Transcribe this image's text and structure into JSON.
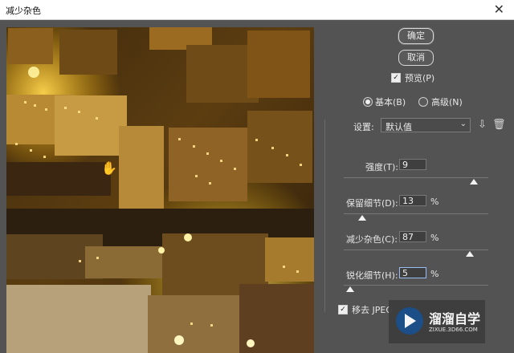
{
  "window": {
    "title": "减少杂色"
  },
  "buttons": {
    "ok": "确定",
    "cancel": "取消"
  },
  "preview": {
    "label": "预览(P)",
    "checked": true
  },
  "mode": {
    "basic": "基本(B)",
    "advanced": "高级(N)",
    "selected": "basic"
  },
  "settings": {
    "label": "设置:",
    "value": "默认值"
  },
  "controls": [
    {
      "label": "强度(T):",
      "value": "9",
      "unit": "",
      "level": 0.9
    },
    {
      "label": "保留细节(D):",
      "value": "13",
      "unit": "%",
      "level": 0.13
    },
    {
      "label": "减少杂色(C):",
      "value": "87",
      "unit": "%",
      "level": 0.87
    },
    {
      "label": "锐化细节(H):",
      "value": "5",
      "unit": "%",
      "level": 0.05
    }
  ],
  "jpeg": {
    "label": "移去 JPEG",
    "checked": true
  },
  "watermark": {
    "name": "溜溜自学",
    "site": "ZIXUE.3D66.COM"
  }
}
